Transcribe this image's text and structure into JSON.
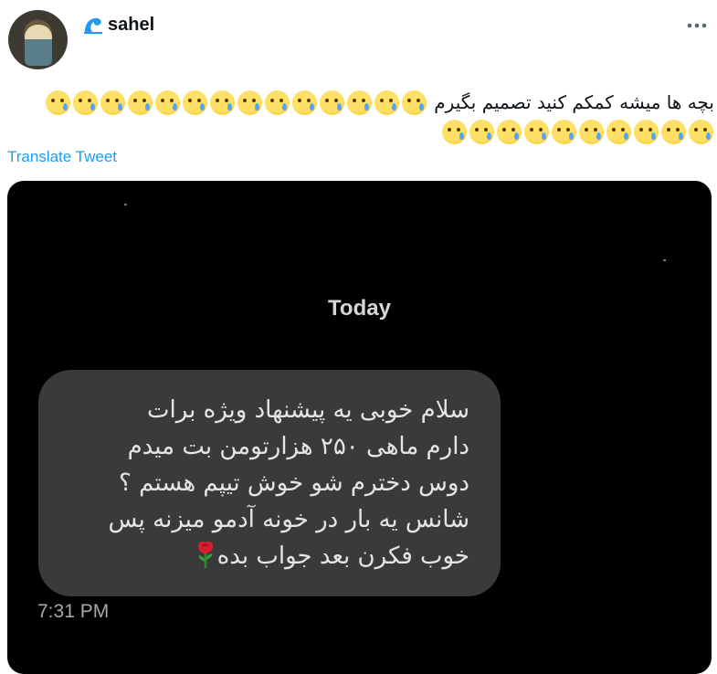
{
  "author": {
    "display_name": "sahel",
    "avatar_icon": "profile-photo",
    "badge_icon": "wave-icon"
  },
  "tweet": {
    "text": "بچه ها  میشه کمکم کنید تصمیم بگیرم",
    "emoji_name": "face-savoring-food-with-tear-emoji",
    "emoji_count": 24,
    "translate_label": "Translate Tweet"
  },
  "media": {
    "date_label": "Today",
    "message_text": "سلام خوبی  یه پیشنهاد ویژه برات\nدارم ماهی ۲۵۰ هزارتومن بت میدم\nدوس دخترم شو خوش تیپم هستم ؟\nشانس یه بار در خونه آدمو میزنه  پس\nخوب فکرن بعد جواب بده",
    "message_emoji": "rose-icon",
    "time": "7:31 PM"
  },
  "colors": {
    "link": "#1d9bf0",
    "text": "#0f1419",
    "media_bg": "#000000",
    "bubble_bg": "#3a3a3c"
  }
}
